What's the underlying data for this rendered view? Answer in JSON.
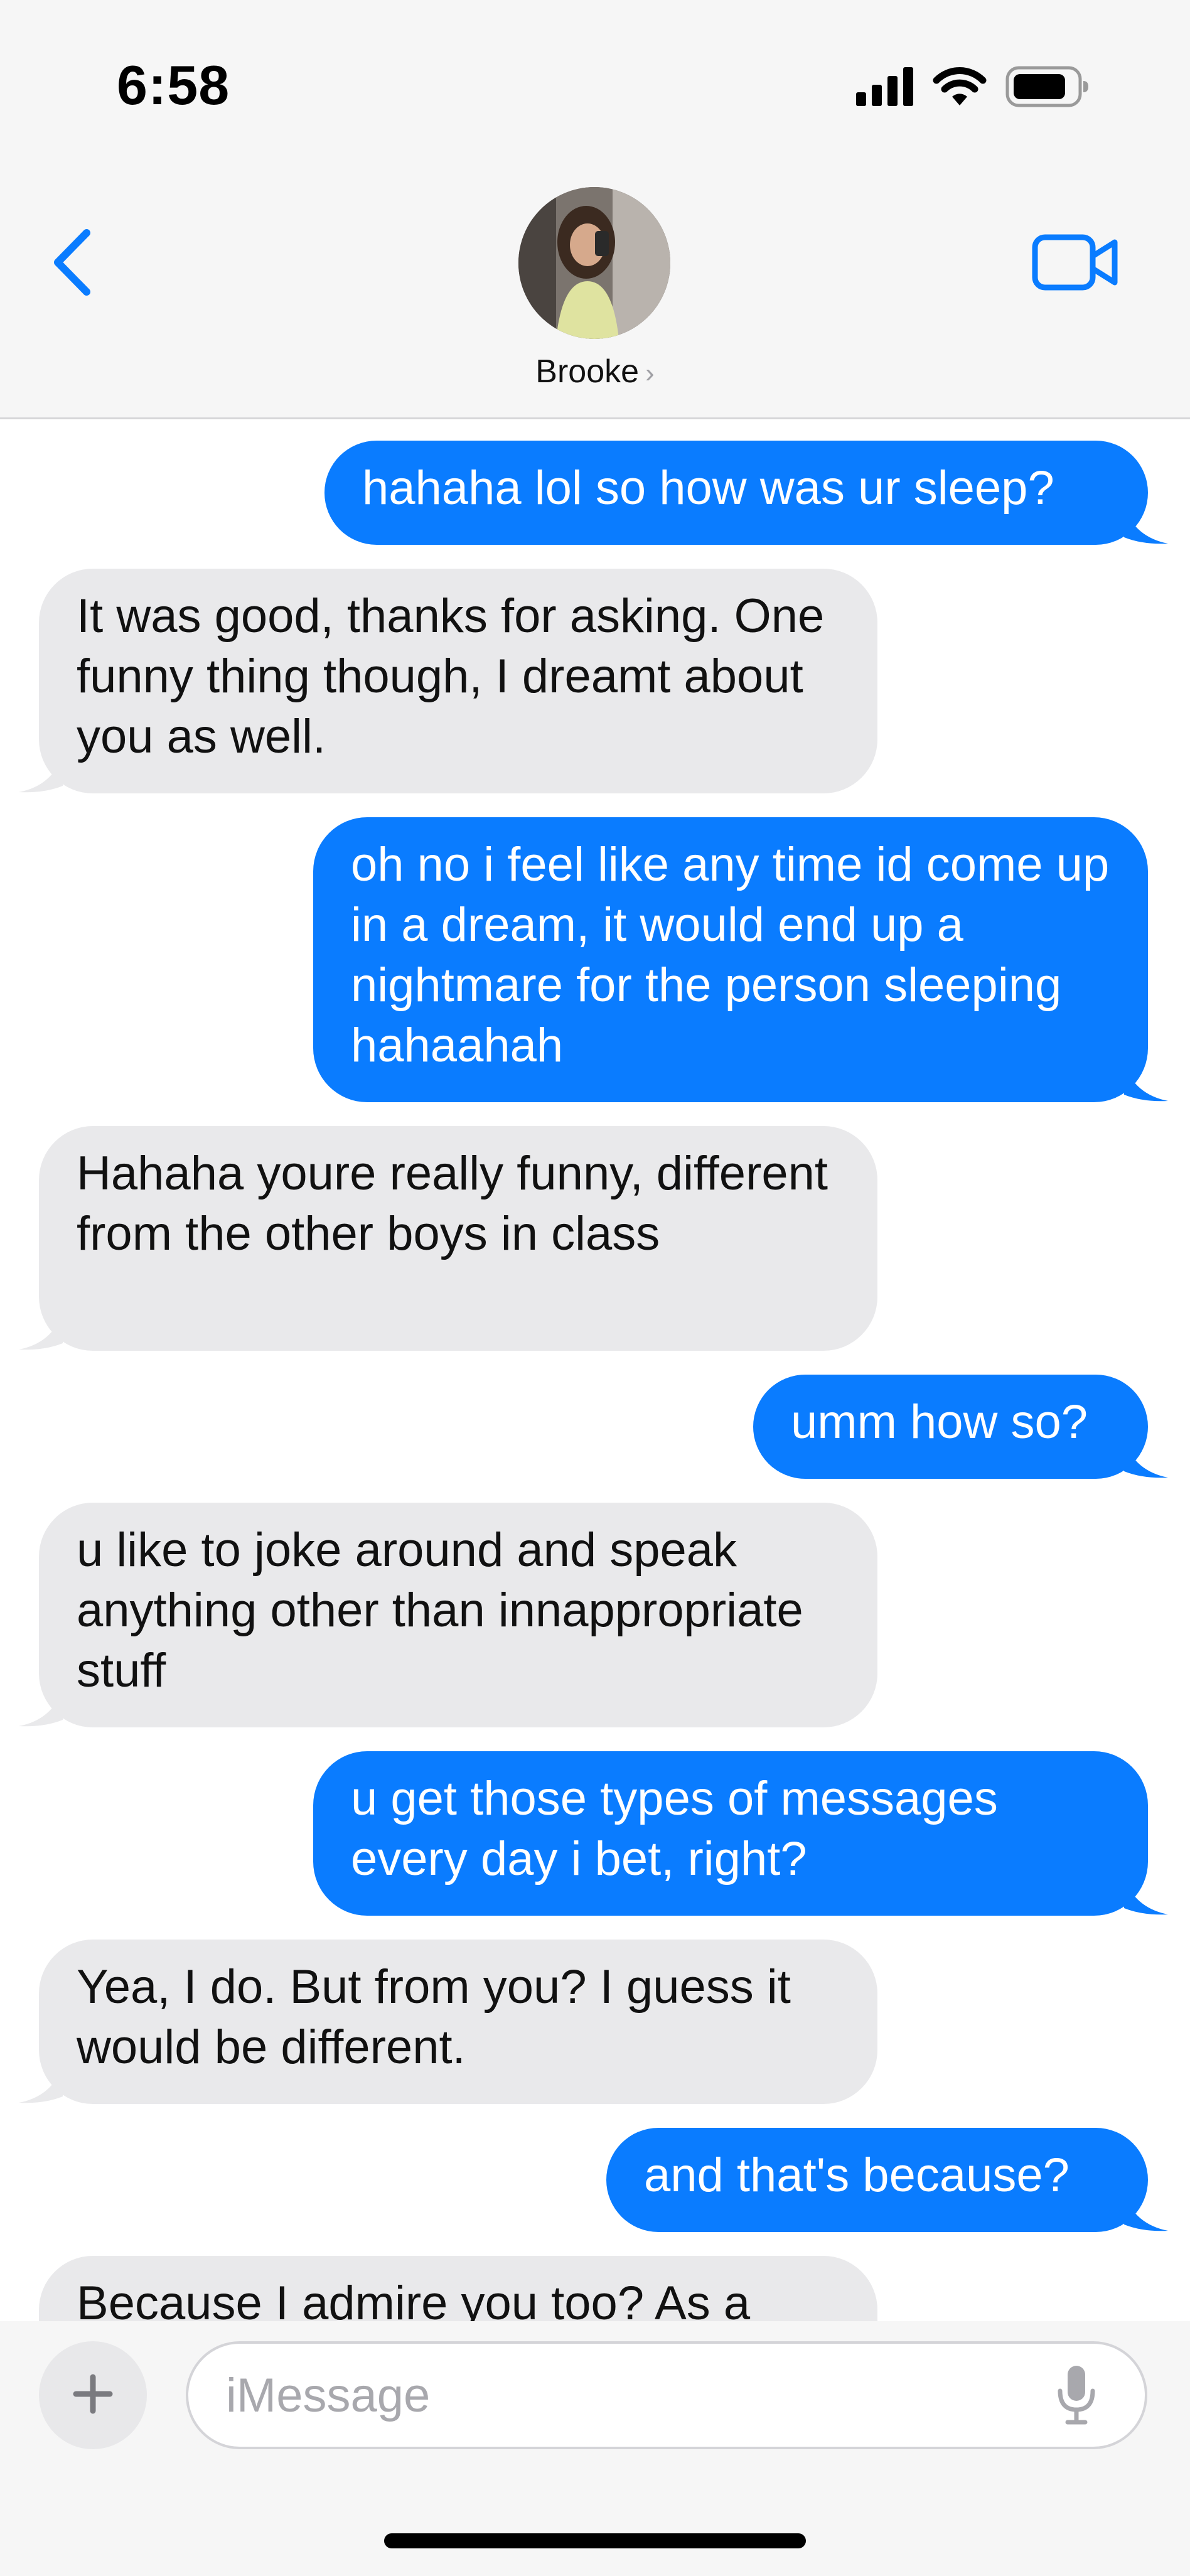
{
  "status_bar": {
    "time": "6:58",
    "icons": [
      "cellular-signal-icon",
      "wifi-icon",
      "battery-icon"
    ]
  },
  "header": {
    "contact_name": "Brooke",
    "contact_chevron": "›",
    "back_icon": "chevron-left-icon",
    "video_icon": "video-camera-icon"
  },
  "messages": [
    {
      "from": "me",
      "text": "hahaha lol so how was ur sleep?"
    },
    {
      "from": "them",
      "text": "It was good, thanks for asking. One funny thing though, I dreamt about you as well."
    },
    {
      "from": "me",
      "text": "oh no i feel like any time id come up in a dream, it would end up a nightmare for the person sleeping hahaahah"
    },
    {
      "from": "them",
      "text": "Hahaha youre really funny, different from the other boys in class"
    },
    {
      "from": "me",
      "text": "umm how so?"
    },
    {
      "from": "them",
      "text": "u like to joke around and speak anything other than innappropriate stuff"
    },
    {
      "from": "me",
      "text": "u get those types of messages every day i bet, right?"
    },
    {
      "from": "them",
      "text": "Yea, I do. But from you? I guess it would be different."
    },
    {
      "from": "me",
      "text": "and that's because?"
    },
    {
      "from": "them",
      "text": "Because I admire you too? As a"
    }
  ],
  "composer": {
    "placeholder": "iMessage",
    "plus_icon": "plus-icon",
    "mic_icon": "microphone-icon"
  },
  "colors": {
    "sent_bubble": "#0a7cff",
    "received_bubble": "#e9e9eb",
    "accent": "#0a7cff",
    "header_background": "#f6f6f6"
  }
}
